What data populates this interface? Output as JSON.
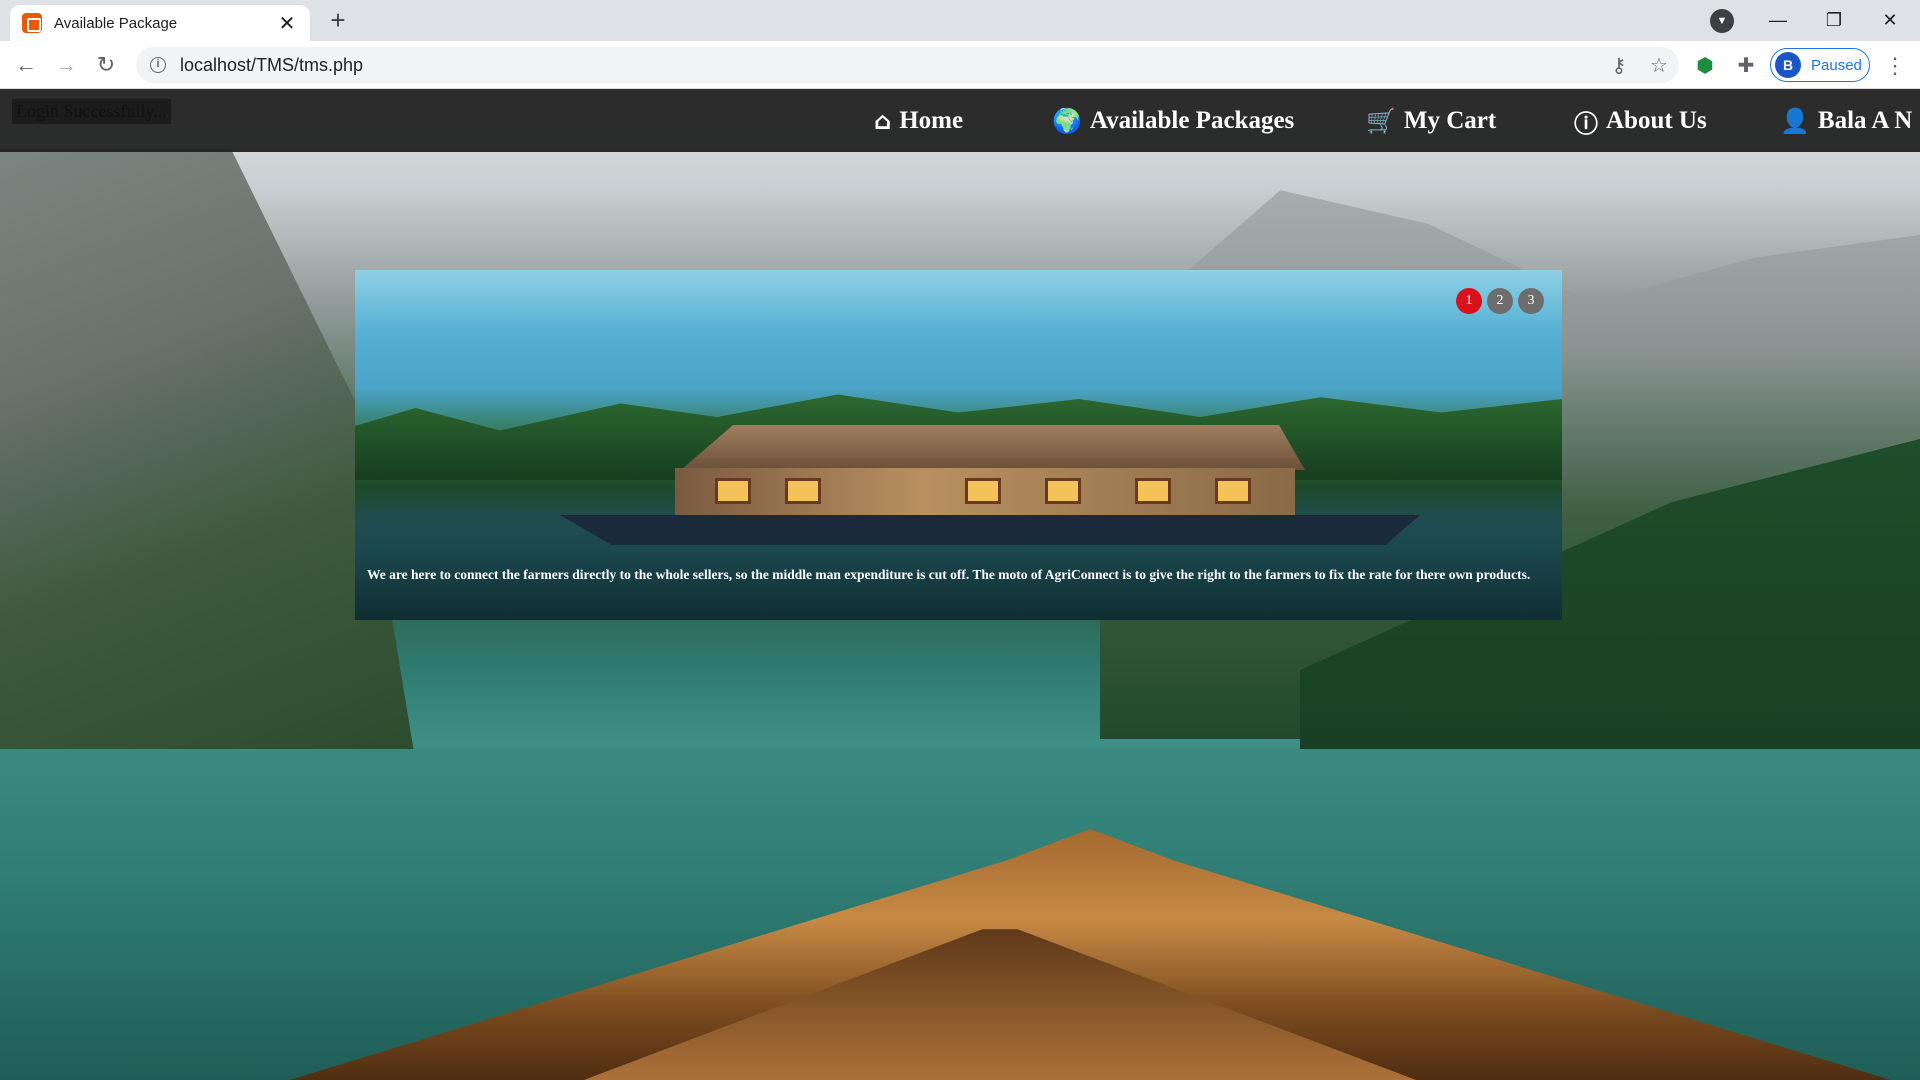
{
  "browser": {
    "tab_title": "Available Package",
    "tab_close": "✕",
    "new_tab": "+",
    "url": "localhost/TMS/tms.php",
    "profile_initial": "B",
    "profile_status": "Paused",
    "window_controls": {
      "minimize": "—",
      "maximize": "❐",
      "close": "✕"
    }
  },
  "site": {
    "login_message": "Login Successfully...",
    "nav": [
      {
        "icon": "home-icon",
        "glyph": "⌂",
        "label": "Home"
      },
      {
        "icon": "globe-icon",
        "glyph": "🌍",
        "label": "Available Packages"
      },
      {
        "icon": "cart-icon",
        "glyph": "🛒",
        "label": "My Cart"
      },
      {
        "icon": "info-icon",
        "glyph": "ⓘ",
        "label": "About Us"
      },
      {
        "icon": "user-icon",
        "glyph": "👤",
        "label": "Bala A N"
      }
    ]
  },
  "slider": {
    "caption": "We are here to connect the farmers directly to the whole sellers, so the middle man expenditure is cut off. The moto of AgriConnect is to give the right to the farmers to fix the rate for there own products.",
    "dots": [
      "1",
      "2",
      "3"
    ],
    "active_index": 0
  }
}
